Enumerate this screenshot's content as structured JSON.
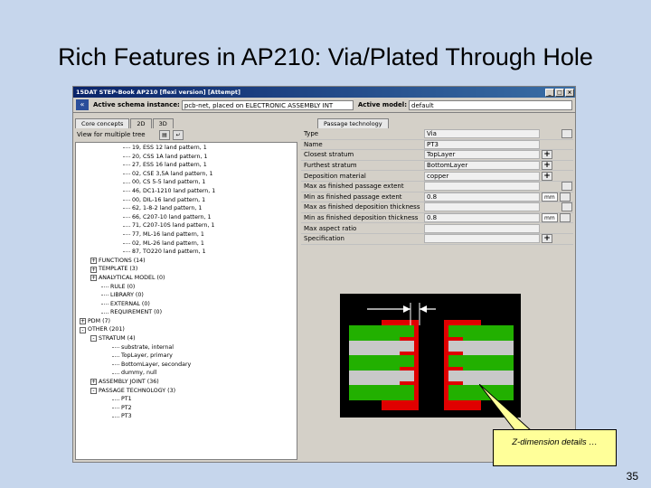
{
  "slide": {
    "title": "Rich Features in AP210: Via/Plated Through Hole",
    "number": "35",
    "callout": "Z-dimension details …"
  },
  "window": {
    "title": "15DAT STEP-Book AP210 [flexi version] [Attempt]",
    "buttons": [
      "_",
      "□",
      "×"
    ]
  },
  "toolbar": {
    "schema_label": "Active schema instance:",
    "schema_value": "pcb-net, placed on ELECTRONIC ASSEMBLY INT",
    "model_label": "Active model:",
    "model_value": "default"
  },
  "left_panel": {
    "tabs": [
      "Core concepts",
      "2D",
      "3D"
    ],
    "view_label": "View for multiple tree",
    "tree": [
      {
        "indent": 4,
        "text": "19, ESS 12 land pattern, 1",
        "exp": ""
      },
      {
        "indent": 4,
        "text": "20, CSS 1A land pattern, 1",
        "exp": ""
      },
      {
        "indent": 4,
        "text": "27, ESS 16 land pattern, 1",
        "exp": ""
      },
      {
        "indent": 4,
        "text": "02, CSE 3,5A land pattern, 1",
        "exp": ""
      },
      {
        "indent": 4,
        "text": "00, CS 5-5 land pattern, 1",
        "exp": ""
      },
      {
        "indent": 4,
        "text": "46, DC1-1210 land pattern, 1",
        "exp": ""
      },
      {
        "indent": 4,
        "text": "00, DIL-16 land pattern, 1",
        "exp": ""
      },
      {
        "indent": 4,
        "text": "62, 1-8-2 land pattern, 1",
        "exp": ""
      },
      {
        "indent": 4,
        "text": "66, C207-10 land pattern, 1",
        "exp": ""
      },
      {
        "indent": 4,
        "text": "71, C207-10S land pattern, 1",
        "exp": ""
      },
      {
        "indent": 4,
        "text": "77, ML-16 land pattern, 1",
        "exp": ""
      },
      {
        "indent": 4,
        "text": "02, ML-26 land pattern, 1",
        "exp": ""
      },
      {
        "indent": 4,
        "text": "87, TO220 land pattern, 1",
        "exp": ""
      },
      {
        "indent": 1,
        "text": "FUNCTIONS (14)",
        "exp": "+"
      },
      {
        "indent": 1,
        "text": "TEMPLATE (3)",
        "exp": "+"
      },
      {
        "indent": 1,
        "text": "ANALYTICAL MODEL (0)",
        "exp": "+"
      },
      {
        "indent": 2,
        "text": "RULE (0)",
        "exp": ""
      },
      {
        "indent": 2,
        "text": "LIBRARY (0)",
        "exp": ""
      },
      {
        "indent": 2,
        "text": "EXTERNAL (0)",
        "exp": ""
      },
      {
        "indent": 2,
        "text": "REQUIREMENT (0)",
        "exp": ""
      },
      {
        "indent": 0,
        "text": "PDM (7)",
        "exp": "+"
      },
      {
        "indent": 0,
        "text": "OTHER (201)",
        "exp": "-"
      },
      {
        "indent": 1,
        "text": "STRATUM (4)",
        "exp": "-"
      },
      {
        "indent": 3,
        "text": "substrate, internal",
        "exp": ""
      },
      {
        "indent": 3,
        "text": "TopLayer, primary",
        "exp": ""
      },
      {
        "indent": 3,
        "text": "BottomLayer, secondary",
        "exp": ""
      },
      {
        "indent": 3,
        "text": "dummy, null",
        "exp": ""
      },
      {
        "indent": 1,
        "text": "ASSEMBLY JOINT (36)",
        "exp": "+"
      },
      {
        "indent": 1,
        "text": "PASSAGE TECHNOLOGY (3)",
        "exp": "-"
      },
      {
        "indent": 3,
        "text": "PT1",
        "exp": ""
      },
      {
        "indent": 3,
        "text": "PT2",
        "exp": ""
      },
      {
        "indent": 3,
        "text": "PT3",
        "exp": ""
      }
    ]
  },
  "right_panel": {
    "tab": "Passage technology",
    "properties": [
      {
        "label": "Type",
        "value": "Via",
        "ctrl": "spin"
      },
      {
        "label": "Name",
        "value": "PT3",
        "ctrl": "none"
      },
      {
        "label": "Closest stratum",
        "value": "TopLayer",
        "ctrl": "plus"
      },
      {
        "label": "Furthest stratum",
        "value": "BottomLayer",
        "ctrl": "plus"
      },
      {
        "label": "Deposition material",
        "value": "copper",
        "ctrl": "plus"
      },
      {
        "label": "Max as finished passage extent",
        "value": "",
        "ctrl": "spin"
      },
      {
        "label": "Min as finished passage extent",
        "value": "0.8",
        "ctrl": "unit",
        "unit": "mm"
      },
      {
        "label": "Max as finished deposition thickness",
        "value": "",
        "ctrl": "spin"
      },
      {
        "label": "Min as finished deposition thickness",
        "value": "0.8",
        "ctrl": "unit",
        "unit": "mm"
      },
      {
        "label": "Max aspect ratio",
        "value": "",
        "ctrl": "none"
      },
      {
        "label": "Specification",
        "value": "",
        "ctrl": "plus"
      }
    ]
  },
  "colors": {
    "slide_bg": "#c6d6ec",
    "window_bg": "#d4d0c8",
    "titlebar": "#0a246a",
    "copper": "#e00000",
    "dielectric_green": "#22b000",
    "dielectric_gray": "#c8c8c8",
    "callout_bg": "#ffff99"
  },
  "icons": [
    "nav-back-icon",
    "expand-plus-icon",
    "collapse-minus-icon",
    "add-plus-icon"
  ]
}
